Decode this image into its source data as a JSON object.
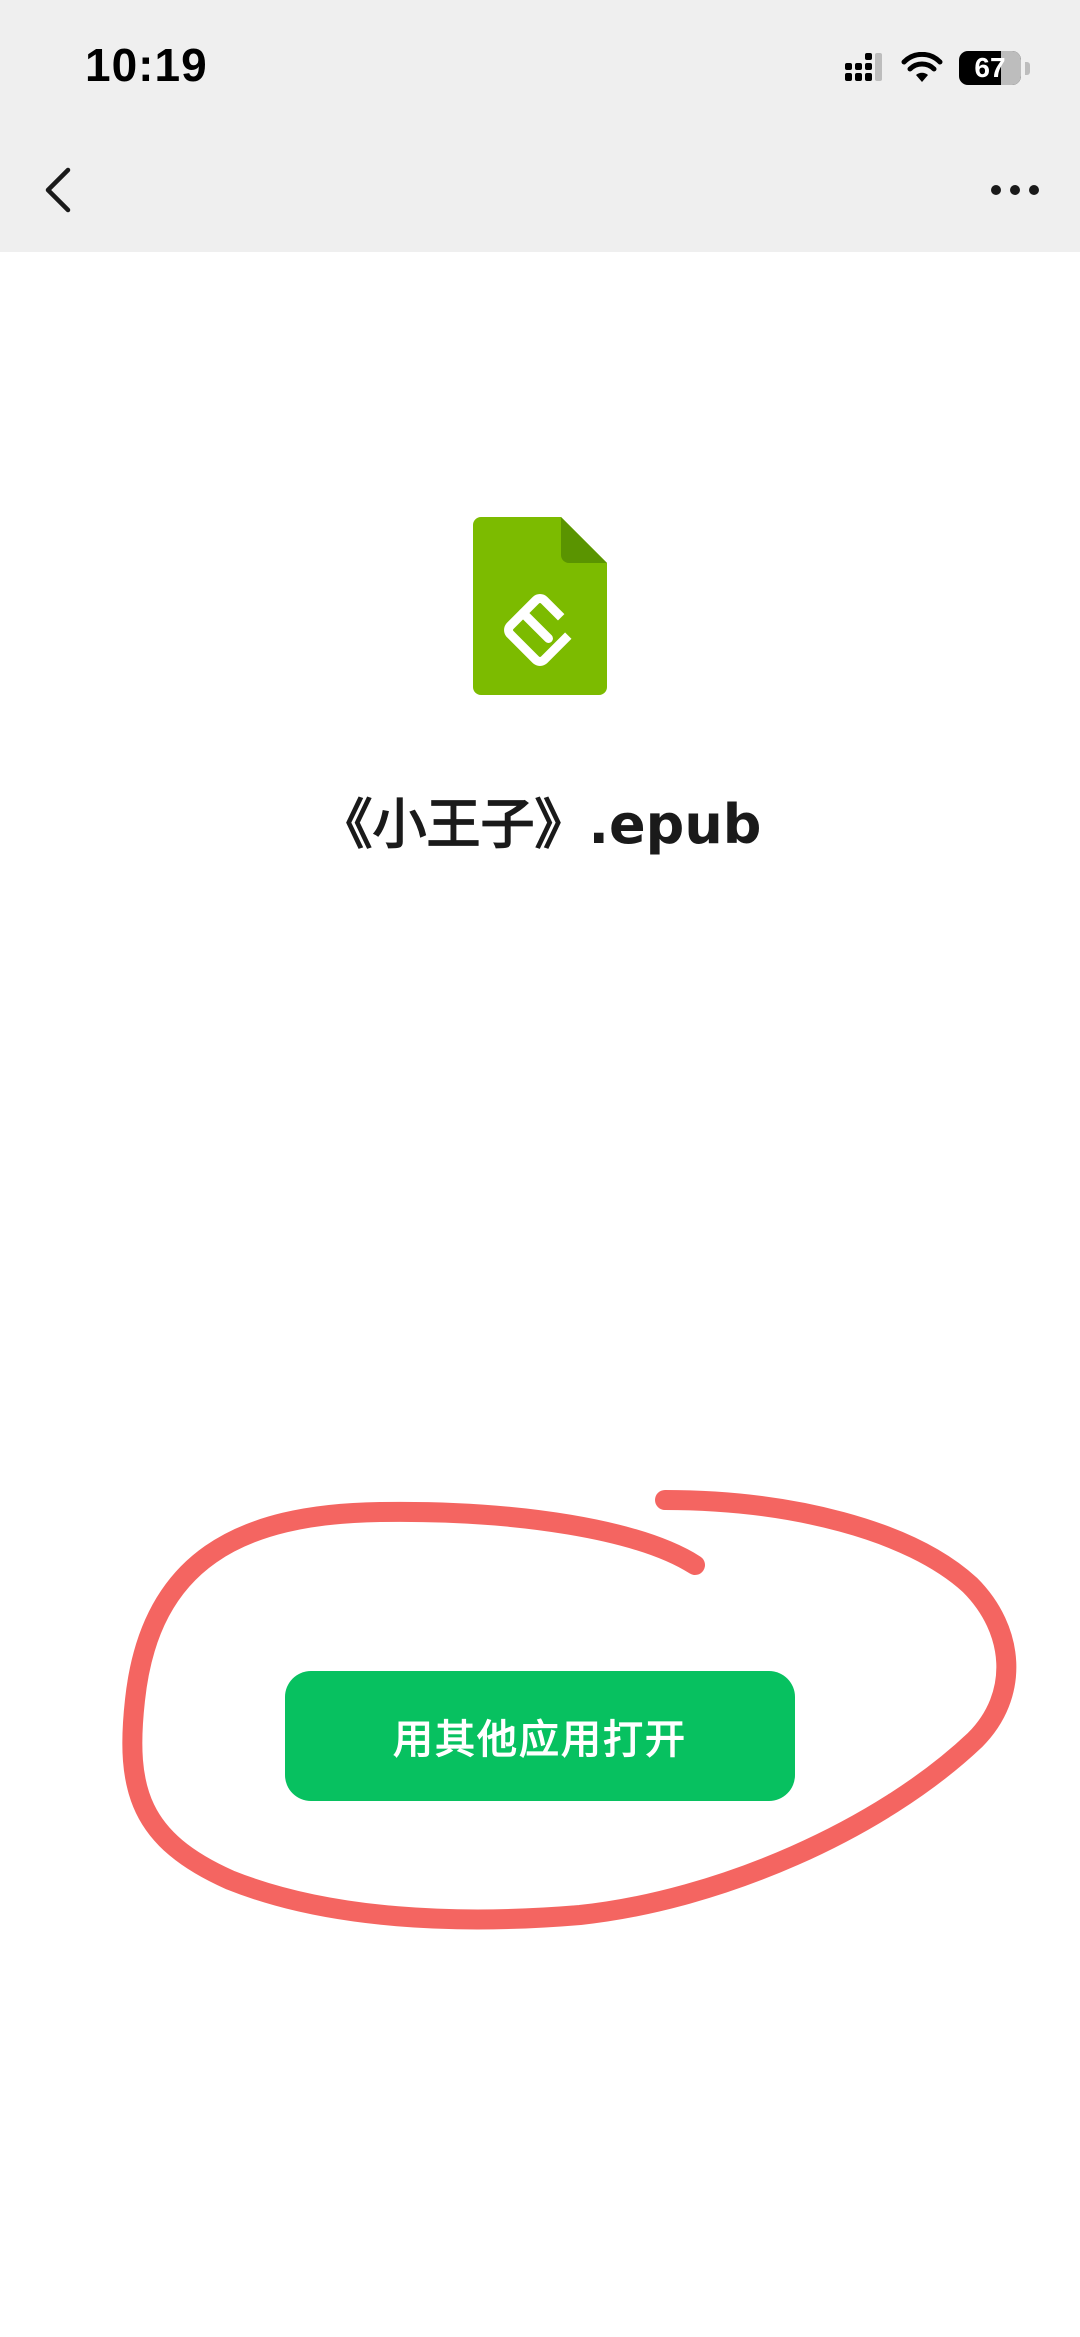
{
  "status_bar": {
    "time": "10:19",
    "battery_level": "67",
    "icons": [
      "cellular-signal-icon",
      "wifi-icon",
      "battery-icon"
    ]
  },
  "nav": {
    "back_icon": "chevron-left-icon",
    "more_icon": "more-dots-icon"
  },
  "file": {
    "name": "《小王子》.epub",
    "icon": "epub-file-icon",
    "icon_color": "#7cbb00"
  },
  "actions": {
    "open_with_label": "用其他应用打开",
    "accent_color": "#07c160"
  },
  "annotation": {
    "type": "red-hand-drawn-circle",
    "color": "#f2504b"
  }
}
